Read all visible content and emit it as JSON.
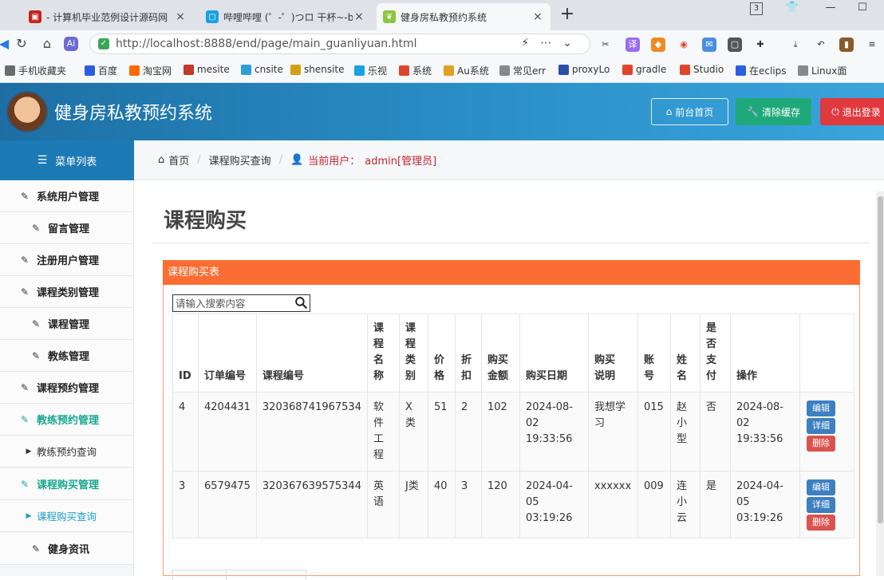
{
  "browser": {
    "tabs": [
      {
        "label": "- 计算机毕业范例设计源码网",
        "close": "×"
      },
      {
        "label": "哔哩哔哩 (゜-゜)つロ 干杯~-bilibili",
        "close": "×"
      },
      {
        "label": "健身房私教预约系统",
        "close": "×"
      }
    ],
    "new_tab": "+",
    "window_badge": "3",
    "url": "http://localhost:8888/end/page/main_guanliyuan.html",
    "bookmarks": [
      {
        "label": "手机收藏夹",
        "color": "#6b6b6b"
      },
      {
        "label": "百度",
        "color": "#2b5ee0"
      },
      {
        "label": "淘宝网",
        "color": "#ff6a00"
      },
      {
        "label": "mesite",
        "color": "#c0392b"
      },
      {
        "label": "cnsite",
        "color": "#2d9fd8"
      },
      {
        "label": "shensite",
        "color": "#d4a017"
      },
      {
        "label": "乐视",
        "color": "#1aa1e1"
      },
      {
        "label": "系统",
        "color": "#e0452c"
      },
      {
        "label": "Au系统",
        "color": "#e0a020"
      },
      {
        "label": "常见err",
        "color": "#888888"
      },
      {
        "label": "proxyLo",
        "color": "#2b4fa8"
      },
      {
        "label": "gradle",
        "color": "#e0452c"
      },
      {
        "label": "Studio",
        "color": "#e0452c"
      },
      {
        "label": "在eclips",
        "color": "#2b5ee0"
      },
      {
        "label": "Linux面",
        "color": "#888888"
      }
    ]
  },
  "header": {
    "title": "健身房私教预约系统",
    "home_button": "前台首页",
    "cache_button": "清除缓存",
    "logout_button": "退出登录"
  },
  "sidebar": {
    "heading": "菜单列表",
    "items": [
      {
        "label": "系统用户管理",
        "level": "l1"
      },
      {
        "label": "留言管理",
        "level": "l2"
      },
      {
        "label": "注册用户管理",
        "level": "l1"
      },
      {
        "label": "课程类别管理",
        "level": "l1"
      },
      {
        "label": "课程管理",
        "level": "l2"
      },
      {
        "label": "教练管理",
        "level": "l2"
      },
      {
        "label": "课程预约管理",
        "level": "l1"
      },
      {
        "label": "教练预约管理",
        "level": "l1"
      },
      {
        "label": "教练预约查询",
        "level": "sub"
      },
      {
        "label": "课程购买管理",
        "level": "l1"
      },
      {
        "label": "课程购买查询",
        "level": "sub"
      },
      {
        "label": "健身资讯",
        "level": "l2"
      }
    ]
  },
  "breadcrumb": {
    "home": "首页",
    "current": "课程购买查询",
    "user_label": "当前用户：",
    "user_value": "admin[管理员]"
  },
  "main": {
    "title": "课程购买",
    "panel_title": "课程购买表",
    "search_placeholder": "请输入搜索内容",
    "columns": [
      "ID",
      "订单编号",
      "课程编号",
      "课程名称",
      "课程类别",
      "价格",
      "折扣",
      "购买金额",
      "购买日期",
      "购买说明",
      "账号",
      "姓名",
      "是否支付",
      "操作",
      ""
    ],
    "rows": [
      {
        "id": "4",
        "order_no": "4204431",
        "course_no": "320368741967534",
        "course_name": "软件工程",
        "category": "X类",
        "price": "51",
        "discount": "2",
        "amount": "102",
        "date": "2024-08-02 19:33:56",
        "note": "我想学习",
        "account": "015",
        "name": "赵小型",
        "paid": "否",
        "op_date": "2024-08-02 19:33:56"
      },
      {
        "id": "3",
        "order_no": "6579475",
        "course_no": "320367639575344",
        "course_name": "英语",
        "category": "J类",
        "price": "40",
        "discount": "3",
        "amount": "120",
        "date": "2024-04-05 03:19:26",
        "note": "xxxxxx",
        "account": "009",
        "name": "连小云",
        "paid": "是",
        "op_date": "2024-04-05 03:19:26"
      }
    ],
    "actions": {
      "edit": "编辑",
      "detail": "详细",
      "delete": "删除"
    }
  },
  "colors": {
    "header_bg": "#2a8fc8",
    "panel_head": "#fb6d32",
    "cache_btn": "#1fa97a",
    "logout_btn": "#e0393e",
    "active_menu": "#1aa68f",
    "current_sub": "#1a9fc7",
    "user_text": "#c0262d"
  }
}
